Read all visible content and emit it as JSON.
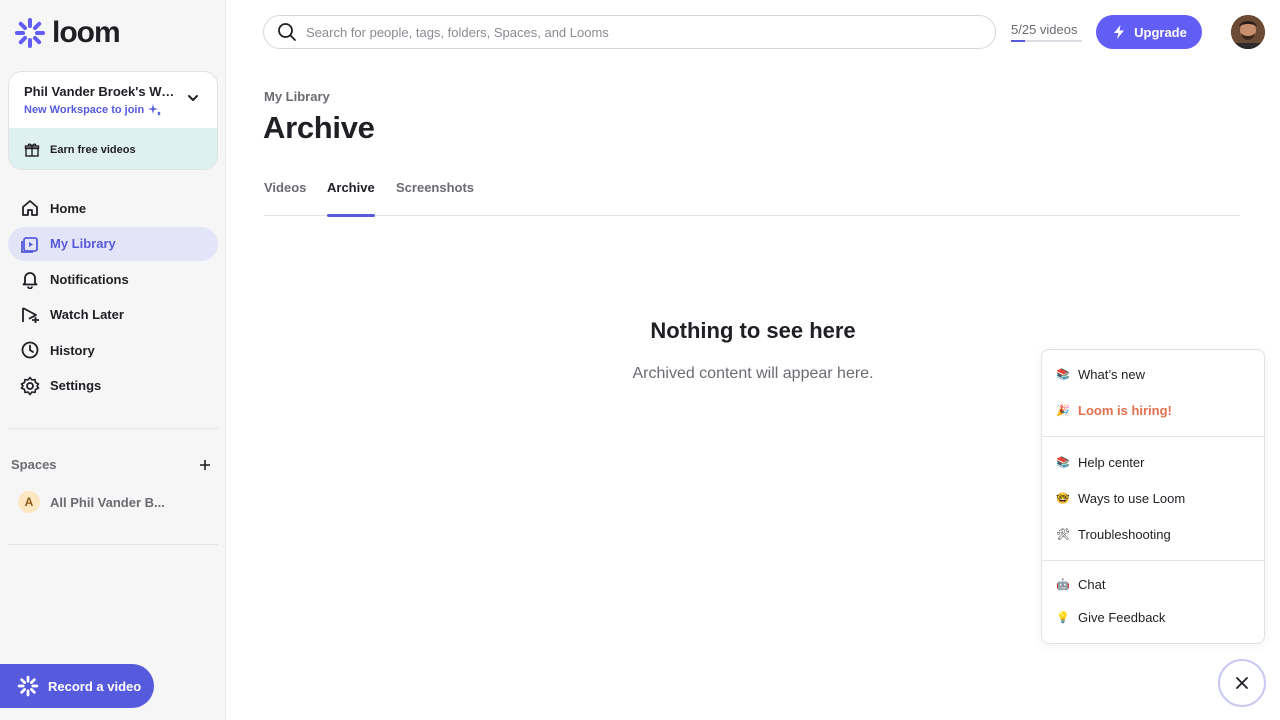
{
  "brand": {
    "name": "loom",
    "accent": "#565add"
  },
  "workspace": {
    "name": "Phil Vander Broek's Wor...",
    "join_label": "New Workspace to join",
    "earn_label": "Earn free videos"
  },
  "nav": {
    "items": [
      {
        "label": "Home",
        "icon": "home-icon"
      },
      {
        "label": "My Library",
        "icon": "library-icon",
        "active": true
      },
      {
        "label": "Notifications",
        "icon": "bell-icon"
      },
      {
        "label": "Watch Later",
        "icon": "watch-later-icon"
      },
      {
        "label": "History",
        "icon": "clock-icon"
      },
      {
        "label": "Settings",
        "icon": "gear-icon"
      }
    ]
  },
  "spaces": {
    "heading": "Spaces",
    "items": [
      {
        "initial": "A",
        "label": "All Phil Vander B..."
      }
    ]
  },
  "record_label": "Record a video",
  "search": {
    "placeholder": "Search for people, tags, folders, Spaces, and Looms"
  },
  "usage": {
    "text": "5/25 videos",
    "used": 5,
    "limit": 25
  },
  "upgrade_label": "Upgrade",
  "breadcrumb": "My Library",
  "page_title": "Archive",
  "tabs": [
    {
      "label": "Videos"
    },
    {
      "label": "Archive",
      "active": true
    },
    {
      "label": "Screenshots"
    }
  ],
  "empty_state": {
    "title": "Nothing to see here",
    "subtitle": "Archived content will appear here."
  },
  "help_menu": {
    "groups": [
      [
        {
          "emoji": "📚",
          "label": "What’s new"
        },
        {
          "emoji": "🎉",
          "label": "Loom is hiring!"
        }
      ],
      [
        {
          "emoji": "📚",
          "label": "Help center"
        },
        {
          "emoji": "🤓",
          "label": "Ways to use Loom"
        },
        {
          "emoji": "🛠",
          "label": "Troubleshooting"
        }
      ],
      [
        {
          "emoji": "🤖",
          "label": "Chat"
        },
        {
          "emoji": "💡",
          "label": "Give Feedback"
        }
      ]
    ]
  }
}
